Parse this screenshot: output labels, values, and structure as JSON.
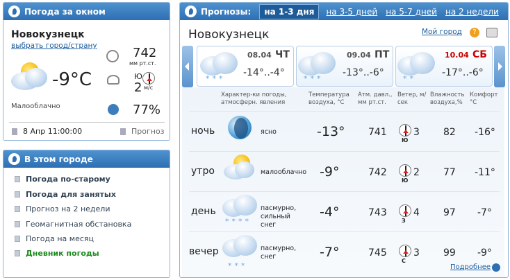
{
  "left_panel": {
    "header": "Погода за окном",
    "city": "Новокузнецк",
    "choose_link": "выбрать город/страну",
    "temp": "-9°C",
    "condition": "Малооблачно",
    "pressure_value": "742",
    "pressure_unit": "мм рт.ст.",
    "wind_dir": "Ю",
    "wind_value": "2",
    "wind_unit": "м/с",
    "humidity": "77%",
    "datetime": "8 Апр 11:00:00",
    "forecast_link": "Прогноз"
  },
  "city_panel": {
    "header": "В этом городе",
    "items": [
      {
        "label": "Погода по-старому",
        "bold": true,
        "green": false
      },
      {
        "label": "Погода для занятых",
        "bold": true,
        "green": false
      },
      {
        "label": "Прогноз на 2 недели",
        "bold": false,
        "green": false
      },
      {
        "label": "Геомагнитная обстановка",
        "bold": false,
        "green": false
      },
      {
        "label": "Погода на месяц",
        "bold": false,
        "green": false
      },
      {
        "label": "Дневник погоды",
        "bold": true,
        "green": true
      }
    ]
  },
  "forecast": {
    "header_label": "Прогнозы:",
    "tabs": [
      "на 1-3 дня",
      "на 3-5 дней",
      "на 5-7 дней",
      "на 2 недели"
    ],
    "city": "Новокузнецк",
    "my_city": "Мой город",
    "days": [
      {
        "date": "08.04",
        "weekday": "ЧТ",
        "temps": "-14°..-4°",
        "weekend": false
      },
      {
        "date": "09.04",
        "weekday": "ПТ",
        "temps": "-13°..-6°",
        "weekend": false
      },
      {
        "date": "10.04",
        "weekday": "СБ",
        "temps": "-17°..-6°",
        "weekend": true
      }
    ],
    "columns": {
      "char": "Характер-ки погоды, атмосферн. явления",
      "temp": "Температура воздуха, °С",
      "press": "Атм. давл., мм рт.ст.",
      "wind": "Ветер, м/сек",
      "hum": "Влажность воздуха,%",
      "comfort": "Комфорт °С"
    },
    "rows": [
      {
        "period": "ночь",
        "desc": "ясно",
        "temp": "-13°",
        "press": "741",
        "wind_dir": "Ю",
        "wind": "3",
        "hum": "82",
        "comfort": "-16°"
      },
      {
        "period": "утро",
        "desc": "малооблачно",
        "temp": "-9°",
        "press": "742",
        "wind_dir": "Ю",
        "wind": "2",
        "hum": "77",
        "comfort": "-11°"
      },
      {
        "period": "день",
        "desc": "пасмурно, сильный снег",
        "temp": "-4°",
        "press": "743",
        "wind_dir": "З",
        "wind": "4",
        "hum": "97",
        "comfort": "-7°"
      },
      {
        "period": "вечер",
        "desc": "пасмурно, снег",
        "temp": "-7°",
        "press": "745",
        "wind_dir": "С",
        "wind": "3",
        "hum": "99",
        "comfort": "-9°"
      }
    ],
    "more_link": "Подробнее"
  },
  "colors": {
    "accent": "#2d6fb2",
    "link": "#1b5d9e",
    "weekend": "#cc0000",
    "green": "#1f8a1f"
  }
}
